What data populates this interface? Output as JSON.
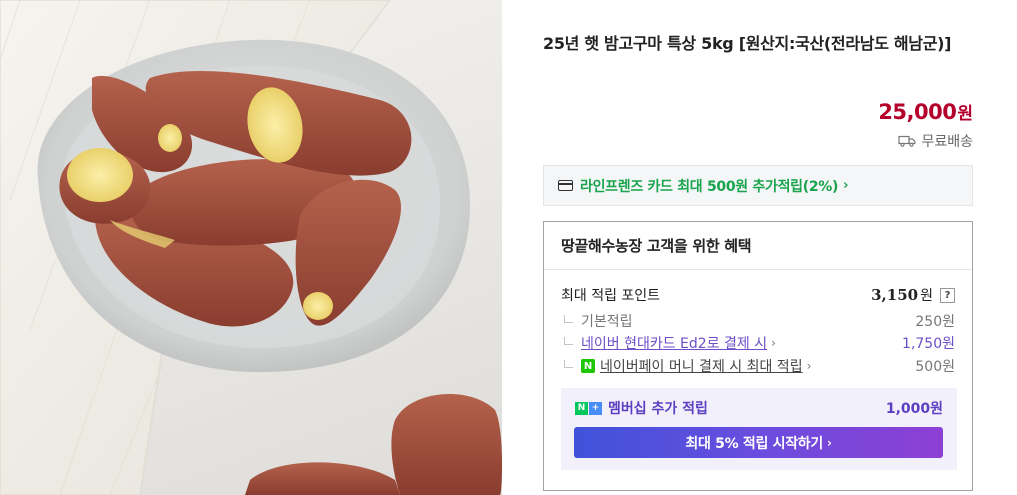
{
  "product": {
    "title": "25년 햇 밤고구마 특상 5kg [원산지:국산(전라남도 해남군)]",
    "price": "25,000",
    "price_unit": "원",
    "shipping": "무료배송",
    "shipping_icon": "truck-icon"
  },
  "card_banner": {
    "text": "라인프렌즈 카드 최대 500원 추가적립(2%)",
    "chevron": "›",
    "icon": "credit-card-icon"
  },
  "benefits": {
    "header": "땅끝해수농장 고객을 위한 혜택",
    "max_points": {
      "label": "최대 적립 포인트",
      "value": "3,150",
      "unit": "원",
      "help": "?"
    },
    "items": [
      {
        "label": "기본적립",
        "value": "250원"
      },
      {
        "label": "네이버 현대카드 Ed2로 결제 시",
        "arrow": "›",
        "value": "1,750원"
      },
      {
        "icon_text": "N",
        "label": "네이버페이 머니 결제 시 최대 적립",
        "arrow": "›",
        "value": "500원"
      }
    ],
    "membership": {
      "badge_n": "N",
      "badge_plus": "+",
      "label": "멤버십 추가 적립",
      "value": "1,000원",
      "button": "최대 5% 적립 시작하기",
      "button_arrow": "›"
    }
  },
  "colors": {
    "price": "#b5002b",
    "naver_green": "#1aa44d",
    "membership_purple": "#5c3fc0"
  }
}
